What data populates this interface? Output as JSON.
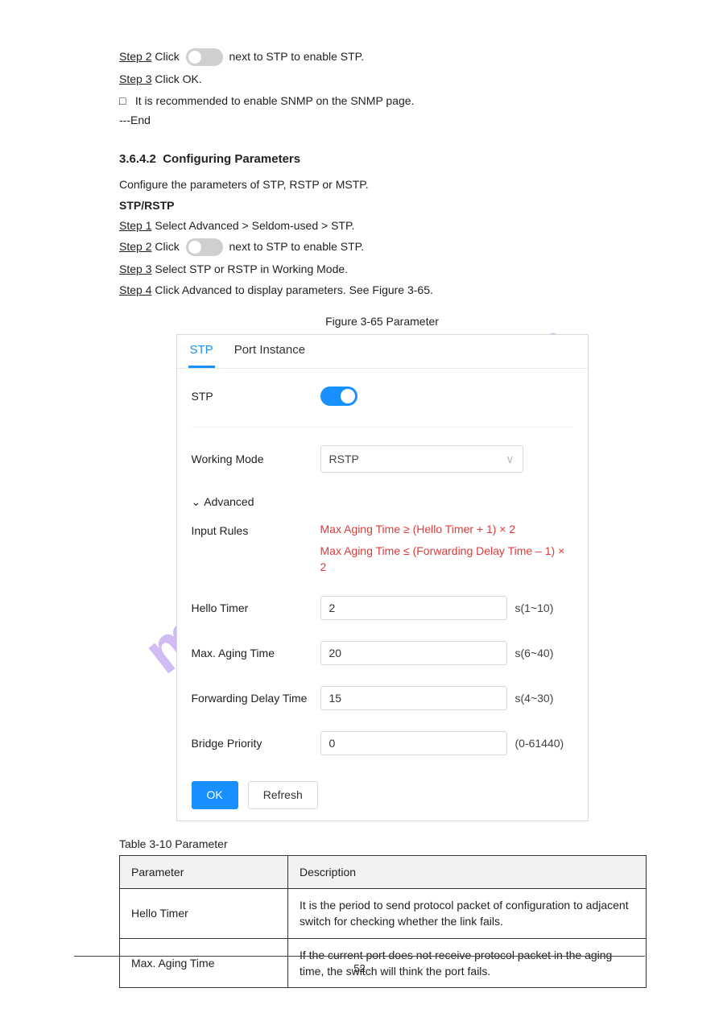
{
  "top": {
    "step2_pre": "Step 2",
    "step2_post": "  Click ",
    "step2_tail": " next to STP to enable STP.",
    "step3_pre": "Step 3",
    "step3_post": "  Click OK.",
    "note_pre": "It is recommended to enable SNMP on the SNMP page.",
    "end": "---End"
  },
  "section": {
    "num": "3.6.4.2",
    "title": "Configuring Parameters",
    "p1": "Configure the parameters of STP, RSTP or MSTP.",
    "h_stp": "STP/RSTP",
    "step1_pre": "Step 1",
    "step1_post": "  Select Advanced > Seldom-used > STP.",
    "step2_pre": "Step 2",
    "step2_post": "  Click ",
    "step2_tail": " next to STP to enable STP.",
    "step3_pre": "Step 3",
    "step3_post": "  Select STP or RSTP in Working Mode.",
    "step4_pre": "Step 4",
    "step4_post": "  Click Advanced to display parameters. See Figure 3-65."
  },
  "figure": {
    "caption": "Figure 3-65 Parameter",
    "tabs": {
      "stp": "STP",
      "port": "Port Instance"
    },
    "row_stp": "STP",
    "row_wm": "Working Mode",
    "wm_value": "RSTP",
    "adv": "Advanced",
    "row_rules": "Input Rules",
    "rule1": "Max Aging Time ≥ (Hello Timer + 1) × 2",
    "rule2": "Max Aging Time ≤ (Forwarding Delay Time – 1) × 2",
    "row_hello": "Hello Timer",
    "hello_val": "2",
    "hello_hint": "s(1~10)",
    "row_max": "Max. Aging Time",
    "max_val": "20",
    "max_hint": "s(6~40)",
    "row_fwd": "Forwarding Delay Time",
    "fwd_val": "15",
    "fwd_hint": "s(4~30)",
    "row_pri": "Bridge Priority",
    "pri_val": "0",
    "pri_hint": "(0-61440)",
    "btn_ok": "OK",
    "btn_refresh": "Refresh"
  },
  "table": {
    "caption": "Table 3-10 Parameter",
    "th1": "Parameter",
    "th2": "Description",
    "r1c1": "Hello Timer",
    "r1c2": "It is the period to send protocol packet of configuration to adjacent switch for checking whether the link fails.",
    "r2c1": "Max. Aging Time",
    "r2c2": "If the current port does not receive protocol packet in the aging time, the switch will think the port fails."
  },
  "footer": {
    "page": "52"
  }
}
